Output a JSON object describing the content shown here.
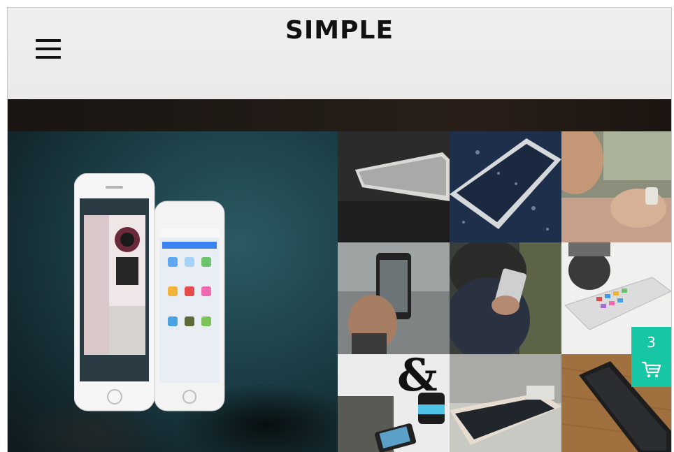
{
  "header": {
    "brand": "SIMPLE",
    "menu_icon": "hamburger-menu-icon"
  },
  "hero": {
    "image": "two-iphones-render"
  },
  "gallery": {
    "items": [
      {
        "image": "white-phone-on-table"
      },
      {
        "image": "phone-water-droplets"
      },
      {
        "image": "hands-holding-phone"
      },
      {
        "image": "hand-photographing-city"
      },
      {
        "image": "person-texting-hoodie"
      },
      {
        "image": "phone-on-desk-white"
      },
      {
        "image": "ampersand-mug-phone"
      },
      {
        "image": "phone-on-white-table"
      },
      {
        "image": "black-phone-on-wood"
      }
    ]
  },
  "cart": {
    "count": "3",
    "icon": "shopping-cart-icon",
    "color": "#16c6a4"
  }
}
